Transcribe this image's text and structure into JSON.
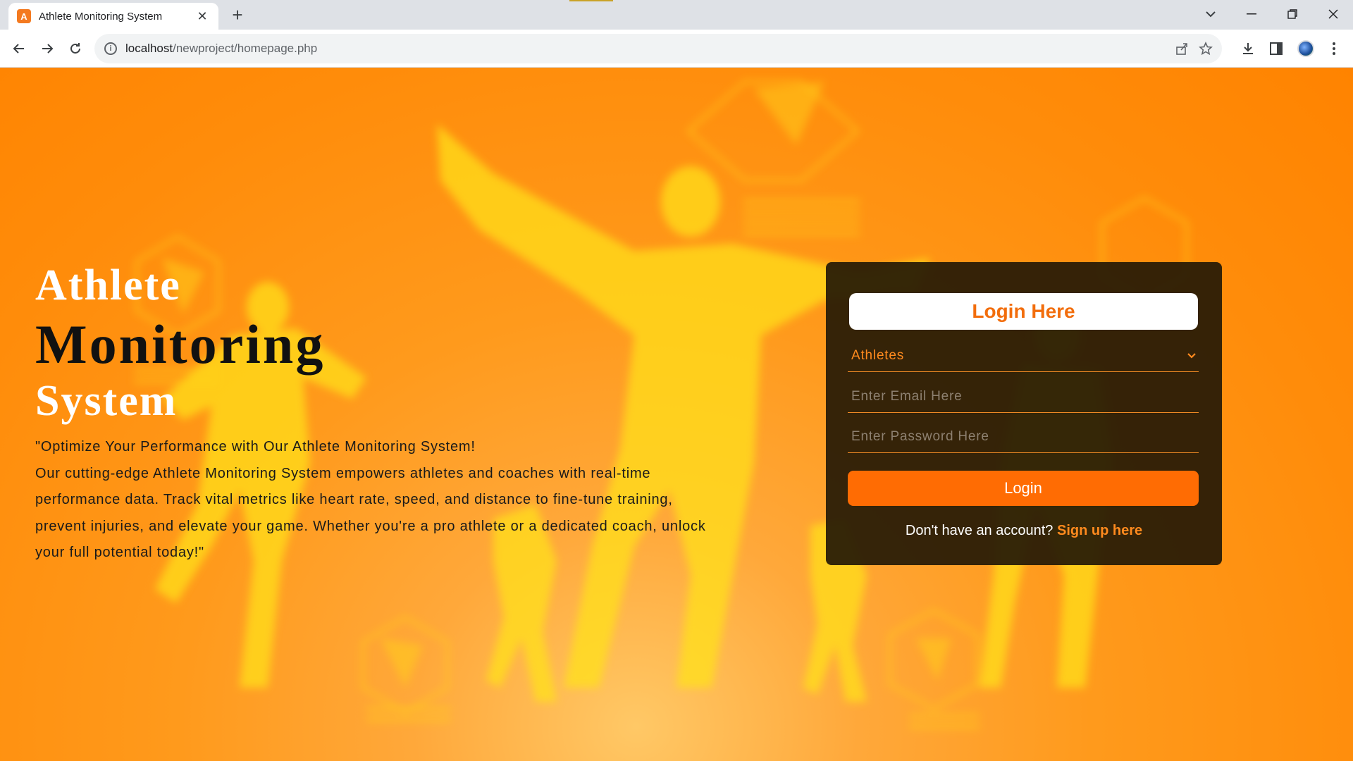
{
  "browser": {
    "tab_title": "Athlete Monitoring System",
    "favicon_letter": "A",
    "url_host": "localhost",
    "url_path": "/newproject/homepage.php"
  },
  "hero": {
    "title_line1": "Athlete",
    "title_line2": "Monitoring",
    "title_line3": "System",
    "tagline": "\"Optimize Your Performance with Our Athlete Monitoring System!",
    "description": "Our cutting-edge Athlete Monitoring System empowers athletes and coaches with real-time performance data. Track vital metrics like heart rate, speed, and distance to fine-tune training, prevent injuries, and elevate your game. Whether you're a pro athlete or a dedicated coach, unlock your full potential today!\""
  },
  "login": {
    "header": "Login Here",
    "role_selected": "Athletes",
    "email_placeholder": "Enter Email Here",
    "password_placeholder": "Enter Password Here",
    "button_label": "Login",
    "signup_prompt": "Don't have an account?",
    "signup_link": "Sign up here"
  },
  "colors": {
    "accent": "#ff6c03",
    "background": "#ff8c0a",
    "card": "#261a06"
  },
  "icons": [
    "back-icon",
    "forward-icon",
    "reload-icon",
    "info-icon",
    "share-icon",
    "star-icon",
    "download-icon",
    "side-panel-icon",
    "menu-icon",
    "chevron-down-icon"
  ]
}
